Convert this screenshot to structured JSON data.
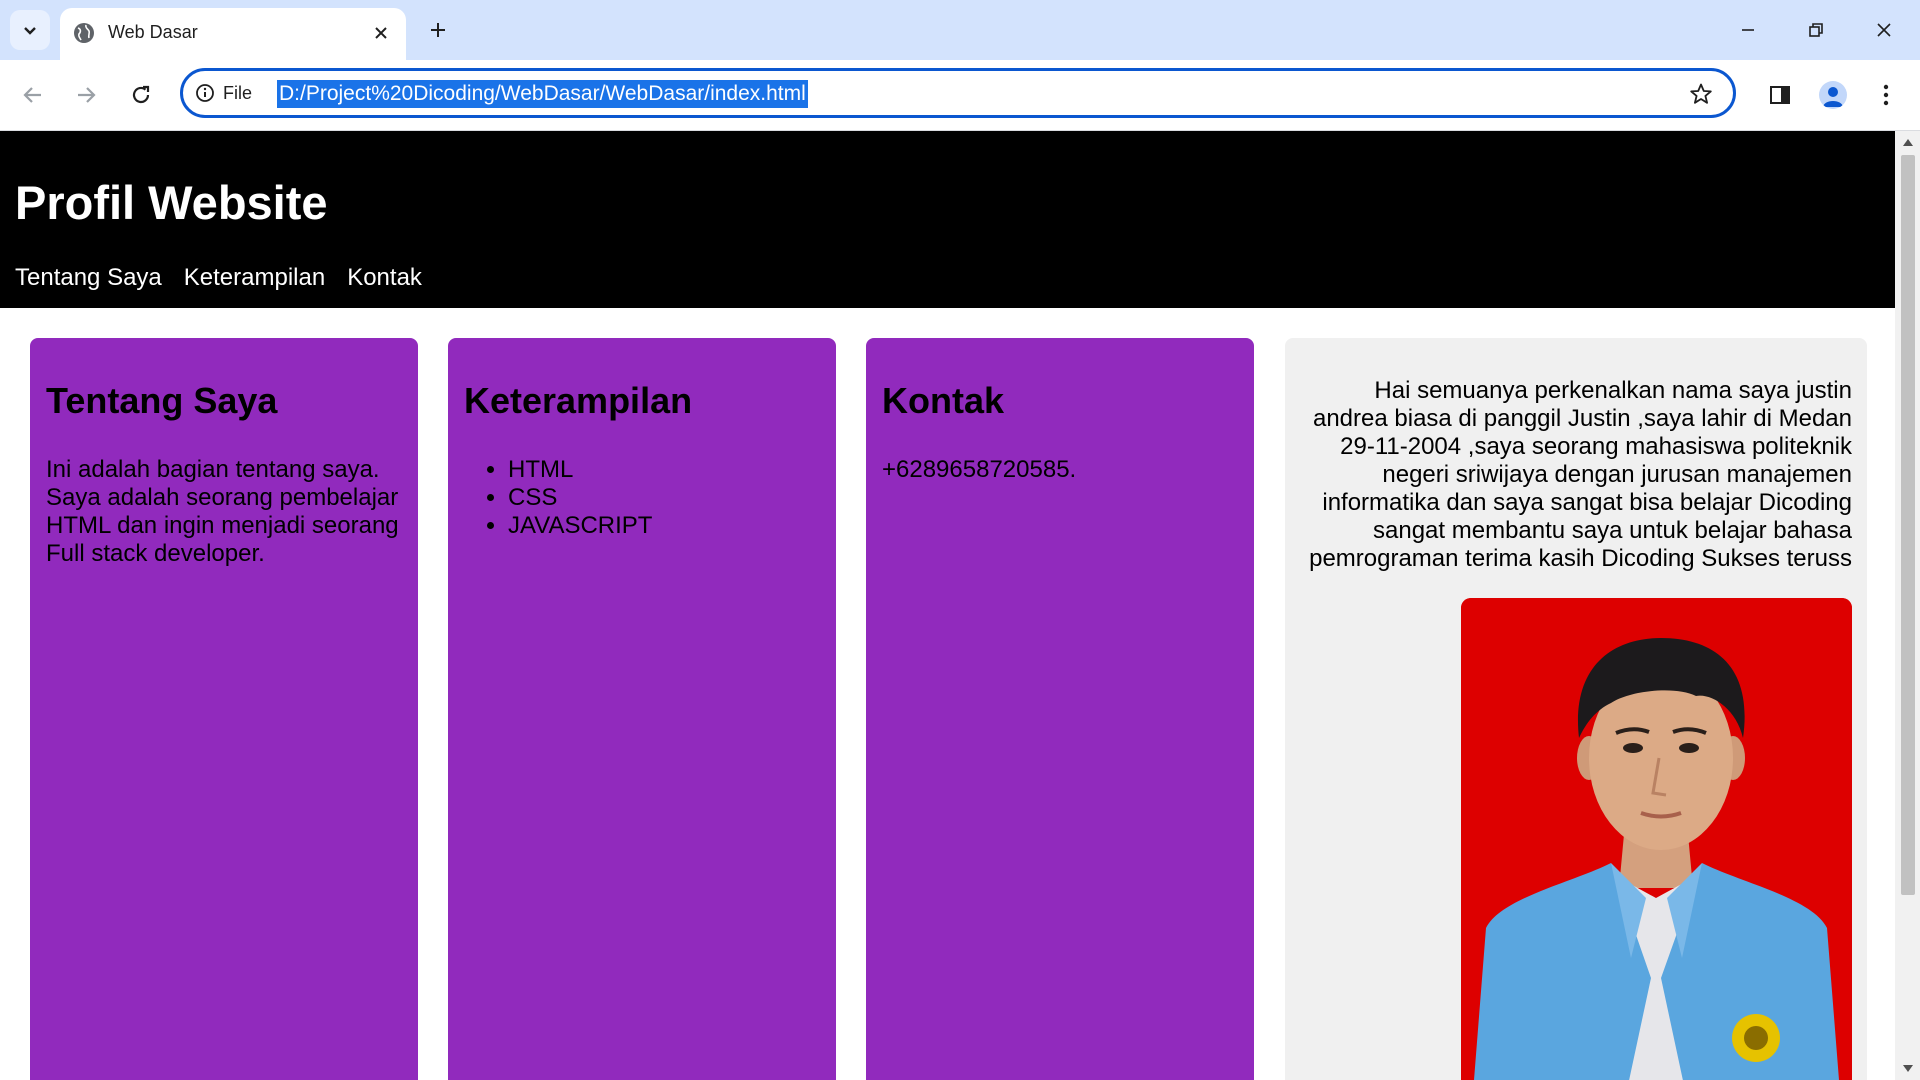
{
  "browser": {
    "tab": {
      "title": "Web Dasar"
    },
    "omnibox": {
      "scheme_label": "File",
      "url": "D:/Project%20Dicoding/WebDasar/WebDasar/index.html"
    },
    "icons": {
      "tab_search": "chevron-down-icon",
      "favicon": "globe-icon",
      "close_tab": "close-icon",
      "new_tab": "plus-icon",
      "minimize": "minimize-icon",
      "restore": "restore-icon",
      "close_window": "close-icon",
      "back": "back-arrow-icon",
      "forward": "forward-arrow-icon",
      "reload": "reload-icon",
      "site_info": "info-icon",
      "bookmark": "star-icon",
      "side_panel": "side-panel-icon",
      "profile": "profile-icon",
      "menu": "more-vert-icon"
    },
    "colors": {
      "tabstrip_bg": "#d3e3fd",
      "accent": "#0b57d0",
      "url_selection": "#1a73e8"
    }
  },
  "page": {
    "header": {
      "title": "Profil Website",
      "nav": [
        {
          "label": "Tentang Saya"
        },
        {
          "label": "Keterampilan"
        },
        {
          "label": "Kontak"
        }
      ]
    },
    "cards": {
      "about": {
        "heading": "Tentang Saya",
        "text": "Ini adalah bagian tentang saya. Saya adalah seorang pembelajar HTML dan ingin menjadi seorang Full stack developer."
      },
      "skills": {
        "heading": "Keterampilan",
        "items": [
          "HTML",
          "CSS",
          "JAVASCRIPT"
        ]
      },
      "contact": {
        "heading": "Kontak",
        "text": "+6289658720585."
      }
    },
    "aside": {
      "text": "Hai semuanya perkenalkan nama saya justin andrea biasa di panggil Justin ,saya lahir di Medan 29-11-2004 ,saya seorang mahasiswa politeknik negeri sriwijaya dengan jurusan manajemen informatika dan saya sangat bisa belajar Dicoding sangat membantu saya untuk belajar bahasa pemrograman terima kasih Dicoding Sukses teruss",
      "photo": "profile-photo"
    },
    "colors": {
      "header_bg": "#000000",
      "card_bg": "#912abd",
      "aside_bg": "#f0f0f0",
      "photo_bg": "#dd0000"
    }
  }
}
